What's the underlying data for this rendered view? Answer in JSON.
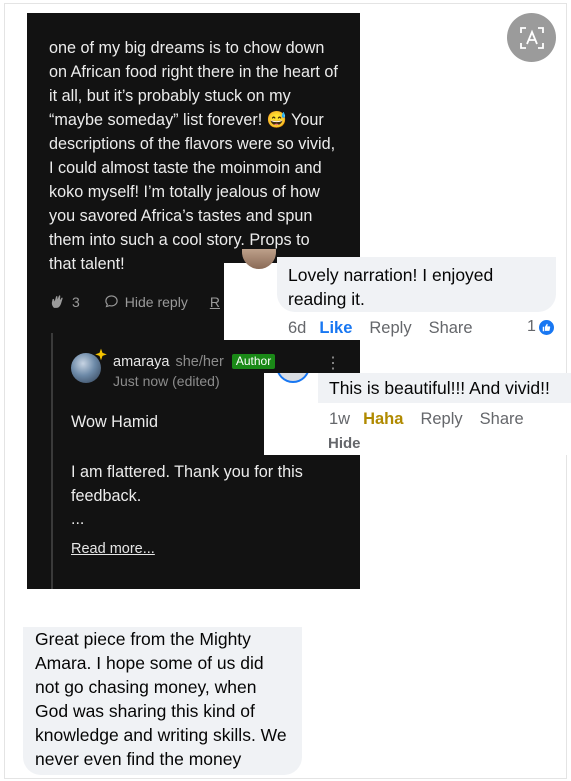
{
  "medium_comment": {
    "body": "one of my big dreams is to chow down on African food right there in the heart of it all, but it’s probably stuck on my “maybe someday” list forever! 😅 Your descriptions of the flavors were so vivid, I could almost taste the moinmoin and koko myself! I’m totally jealous of how you savored Africa’s tastes and spun them into such a cool story. Props to that talent!",
    "clap_count": "3",
    "hide_reply_label": "Hide reply",
    "cut_action_label": "R",
    "reply": {
      "author": "amaraya",
      "pronouns": "she/her",
      "author_badge": "Author",
      "timestamp": "Just now (edited)",
      "greeting": "Wow Hamid",
      "text": "I am flattered. Thank you for this feedback.",
      "ellipsis": "...",
      "read_more_label": "Read more..."
    }
  },
  "fb_comment_1": {
    "text": "Lovely narration! I enjoyed reading it.",
    "time": "6d",
    "like_label": "Like",
    "reply_label": "Reply",
    "share_label": "Share",
    "reaction_count": "1"
  },
  "fb_comment_2": {
    "text": "This is beautiful!!! And vivid!!",
    "time": "1w",
    "reaction_label": "Haha",
    "reply_label": "Reply",
    "share_label": "Share",
    "hide_label": "Hide"
  },
  "fb_comment_3": {
    "text": "Great piece from the Mighty Amara. I hope some of us did not go chasing money, when God was sharing this kind of knowledge and writing skills. We never even find the money"
  },
  "colors": {
    "dark_card": "#121212",
    "author_badge": "#1a8917",
    "fb_bubble": "#f0f2f5",
    "fb_like": "#1877f2",
    "fb_haha": "#b08a00"
  },
  "icons": [
    "clap-icon",
    "chat-bubble-icon",
    "more-vertical-icon",
    "like-reaction-icon",
    "translate-icon"
  ]
}
